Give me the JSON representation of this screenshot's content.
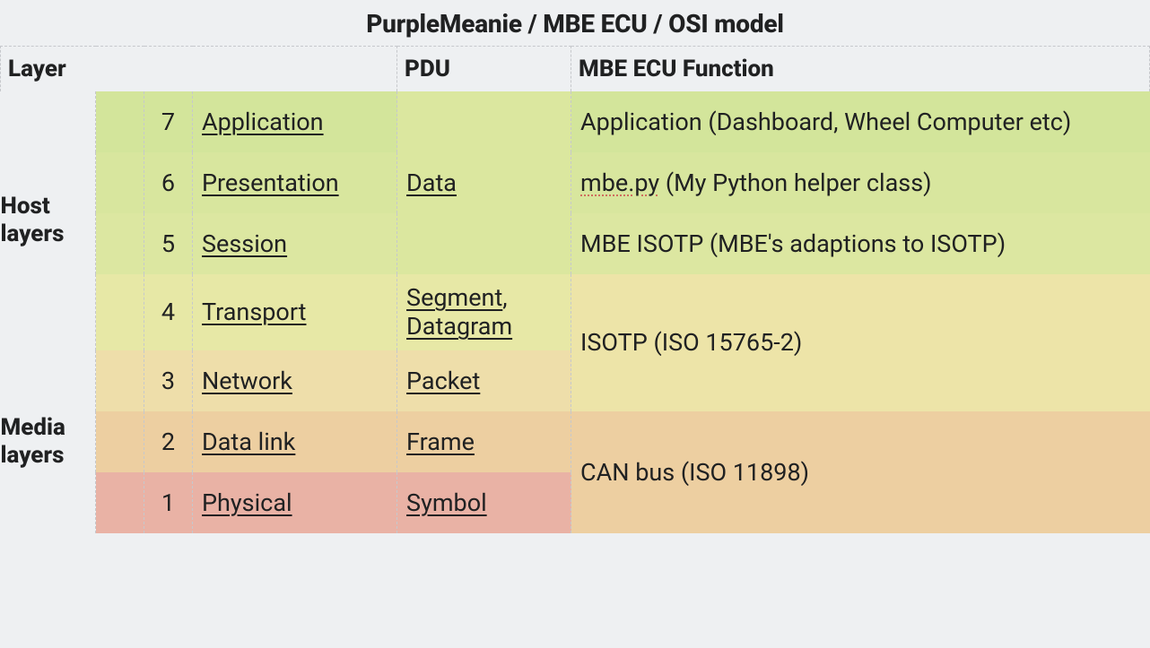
{
  "title": "PurpleMeanie / MBE ECU / OSI model",
  "headers": {
    "layer": "Layer",
    "pdu": "PDU",
    "function": "MBE ECU Function"
  },
  "groups": {
    "host": "Host layers",
    "media": "Media layers"
  },
  "layers": {
    "l7": {
      "num": "7",
      "name": "Application"
    },
    "l6": {
      "num": "6",
      "name": "Presentation"
    },
    "l5": {
      "num": "5",
      "name": "Session"
    },
    "l4": {
      "num": "4",
      "name": "Transport"
    },
    "l3": {
      "num": "3",
      "name": "Network"
    },
    "l2": {
      "num": "2",
      "name": "Data link"
    },
    "l1": {
      "num": "1",
      "name": "Physical"
    }
  },
  "pdus": {
    "data": "Data",
    "segment": "Segment",
    "datagram": "Datagram",
    "packet": "Packet",
    "frame": "Frame",
    "symbol": "Symbol"
  },
  "functions": {
    "l7": "Application (Dashboard, Wheel Computer etc)",
    "l6_pre": "mbe.py",
    "l6_post": " (My Python helper class)",
    "l5": "MBE ISOTP (MBE's adaptions to ISOTP)",
    "isotp": "ISOTP (ISO 15765-2)",
    "can": "CAN bus (ISO 11898)"
  }
}
